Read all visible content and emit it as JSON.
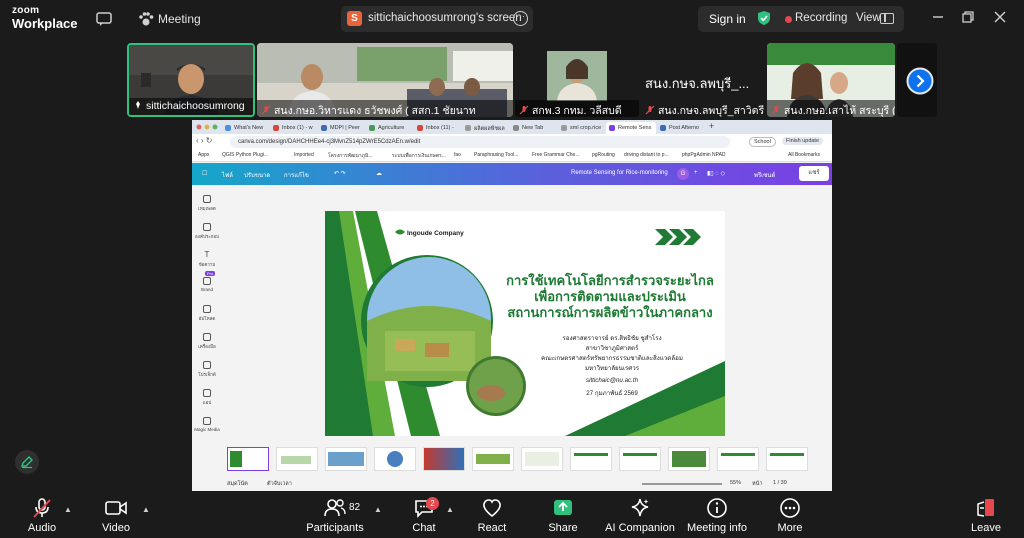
{
  "app": {
    "logo_line1": "zoom",
    "logo_line2": "Workplace",
    "meeting_label": "Meeting",
    "share_initial": "S",
    "share_title": "sittichaichoosumrong's screen",
    "sign_in": "Sign in",
    "recording": "Recording",
    "view": "View",
    "accent": "#0e72ed",
    "rec_color": "#e5484d",
    "active_speaker_color": "#2ec27e"
  },
  "participants": [
    {
      "name": "sittichaichoosumrong",
      "muted": false
    },
    {
      "name": "สนง.กษอ.วิหารแดง ธวัชพงศ์ ( สสก.1 ชัยนาท",
      "muted": true
    },
    {
      "name": "สกพ.3 กทม. วลีสบดี",
      "muted": true
    },
    {
      "name": "สนง.กษจ.ลพบุรี_สาวิตรี",
      "muted": true,
      "label_only": "สนง.กษจ.ลพบุรี_..."
    },
    {
      "name": "สนง.กษอ.เสาไห้ สระบุรี (ศิ...",
      "muted": true
    }
  ],
  "browser": {
    "tabs": [
      "What's New",
      "Inbox (1) - w",
      "MDPI | Peer",
      "Agriculture",
      "Inbox (11) -",
      "ผลิตผลพืชผล",
      "New Tab",
      "sml crop.rice",
      "Remote Sens",
      "Post Afterno"
    ],
    "active_tab": 8,
    "url": "canva.com/design/DAHCHHEe4-cj3MvnZ514pZWrE5CdzAEn.w/edit",
    "school": "School",
    "finish_update": "Finish update",
    "bookmarks": [
      "Apps",
      "QGIS Python Plugi...",
      "Imported",
      "โครงการพัฒนาภูมิ...",
      "ระบบเพื่อการเงินเกษตร...",
      "fao",
      "Paraphrasing Tool...",
      "Free Grammar Che...",
      "pgRouting",
      "driving distant to p...",
      "phpPgAdmin NPAD",
      "All Bookmarks"
    ],
    "canva_menu": [
      "ไฟล์",
      "ปรับขนาด",
      "การแก้ไข"
    ],
    "canva_doc_title": "Remote Sensing for Rice-monitoring",
    "canva_avatar": "G",
    "canva_present": "พรีเซนต์",
    "canva_share": "แชร์",
    "side_items": [
      "เทมเพลต",
      "องค์ประกอบ",
      "ข้อความ",
      "Brand",
      "อัปโหลด",
      "เครื่องมือ",
      "โปรเจ็กต์",
      "แอป",
      "Magic Media"
    ],
    "side_badge": "Pro",
    "slide": {
      "company": "Ingoude Company",
      "title_l1": "การใช้เทคโนโลยีการสำรวจระยะไกล",
      "title_l2": "เพื่อการติดตามและประเมิน",
      "title_l3": "สถานการณ์การผลิตข้าวในภาคกลาง",
      "author": "รองศาสตราจารย์ ดร.สิทธิชัย ชูสำโรง",
      "dept": "สาขาวิชาภูมิศาสตร์",
      "faculty": "คณะเกษตรศาสตร์ทรัพยากรธรรมชาติและสิ่งแวดล้อม",
      "univ": "มหาวิทยาลัยนเรศวร",
      "email": "sittichaic@nu.ac.th",
      "date": "27 กุมภาพันธ์ 2569"
    },
    "status_notes": "สมุดโน้ต",
    "status_timer": "ตัวจับเวลา",
    "zoom_level": "55%",
    "page_label": "หน้า",
    "page_counter": "1 / 39"
  },
  "toolbar": {
    "audio": "Audio",
    "video": "Video",
    "participants": "Participants",
    "participant_count": "82",
    "chat": "Chat",
    "chat_badge": "2",
    "react": "React",
    "share": "Share",
    "ai": "AI Companion",
    "info": "Meeting info",
    "more": "More",
    "leave": "Leave"
  }
}
